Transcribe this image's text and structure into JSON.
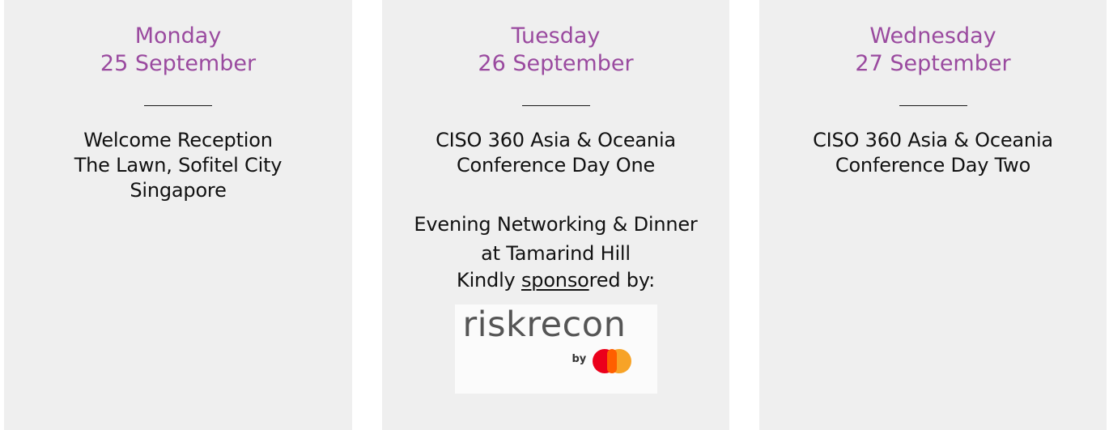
{
  "days": [
    {
      "name": "Monday",
      "date": "25 September",
      "lines": [
        "Welcome Reception",
        "The Lawn, Sofitel City",
        "Singapore"
      ]
    },
    {
      "name": "Tuesday",
      "date": "26 September",
      "lines": [
        "CISO 360 Asia & Oceania",
        "Conference Day One"
      ],
      "evening": [
        "Evening Networking & Dinner",
        "at Tamarind Hill"
      ],
      "sponsor_prefix": "Kindly ",
      "sponsor_underlined": "sponso",
      "sponsor_suffix": "red by:",
      "sponsor_logo": {
        "word": "riskrecon",
        "by": "by",
        "icon": "mastercard-logo-icon",
        "colors": {
          "red": "#eb001b",
          "yellow": "#f79e1b",
          "overlap": "#ff5f00"
        }
      }
    },
    {
      "name": "Wednesday",
      "date": "27 September",
      "lines": [
        "CISO 360 Asia & Oceania",
        "Conference Day Two"
      ]
    }
  ],
  "colors": {
    "accent": "#9a4a9f",
    "card_bg": "#efefef",
    "text": "#111111"
  }
}
